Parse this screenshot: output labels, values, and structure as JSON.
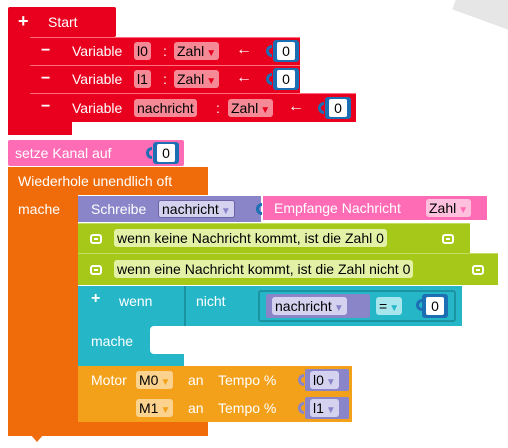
{
  "start": {
    "label": "Start",
    "symbol": "+"
  },
  "variables": [
    {
      "symbol": "−",
      "label": "Variable",
      "name": "l0",
      "colon": ":",
      "type": "Zahl",
      "arrow": "←",
      "value": "0"
    },
    {
      "symbol": "−",
      "label": "Variable",
      "name": "l1",
      "colon": ":",
      "type": "Zahl",
      "arrow": "←",
      "value": "0"
    },
    {
      "symbol": "−",
      "label": "Variable",
      "name": "nachricht",
      "colon": ":",
      "type": "Zahl",
      "arrow": "←",
      "value": "0"
    }
  ],
  "set_channel": {
    "label": "setze Kanal auf",
    "value": "0"
  },
  "forever": {
    "label": "Wiederhole unendlich oft",
    "do_label": "mache"
  },
  "write_block": {
    "label": "Schreibe",
    "variable": "nachricht",
    "receive_label": "Empfange Nachricht",
    "receive_type": "Zahl"
  },
  "comments": [
    "wenn keine Nachricht kommt, ist die Zahl 0",
    "wenn eine Nachricht kommt, ist die Zahl nicht 0"
  ],
  "if_block": {
    "symbol": "+",
    "if_label": "wenn",
    "not_label": "nicht",
    "variable": "nachricht",
    "operator": "=",
    "value": "0",
    "do_label": "mache"
  },
  "motor_block": {
    "label": "Motor",
    "rows": [
      {
        "motor": "M0",
        "word": "an",
        "speed_label": "Tempo %",
        "variable": "l0"
      },
      {
        "motor": "M1",
        "word": "an",
        "speed_label": "Tempo %",
        "variable": "l1"
      }
    ]
  },
  "colors": {
    "start": "#e8001e",
    "variable_field": "#f58a96",
    "number_wrap": "#1d6fb3",
    "channel": "#ff6cb6",
    "forever": "#f06b0a",
    "write": "#8a84c8",
    "receive": "#ff6cb6",
    "comment": "#a6c919",
    "if": "#25b7c8",
    "motor": "#f3a11a"
  }
}
